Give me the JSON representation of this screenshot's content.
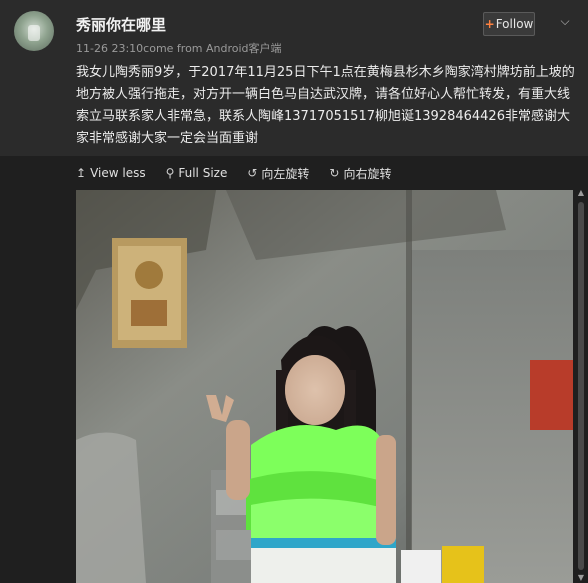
{
  "user": {
    "name": "秀丽你在哪里",
    "meta": "11-26 23:10come from Android客户端"
  },
  "follow": {
    "plus": "+",
    "label": "Follow"
  },
  "post": {
    "text": "我女儿陶秀丽9岁，于2017年11月25日下午1点在黄梅县杉木乡陶家湾村牌坊前上坡的地方被人强行拖走，对方开一辆白色马自达武汉牌，请各位好心人帮忙转发，有重大线索立马联系家人非常急，联系人陶峰13717051517柳旭诞13928464426非常感谢大家非常感谢大家一定会当面重谢"
  },
  "actions": [
    {
      "icon": "arrow-up-icon",
      "label": "View less"
    },
    {
      "icon": "search-icon",
      "label": "Full Size"
    },
    {
      "icon": "rotate-left-icon",
      "label": "向左旋转"
    },
    {
      "icon": "rotate-right-icon",
      "label": "向右旋转"
    }
  ],
  "colors": {
    "background": "#2b2b2b",
    "panel": "#1f1f1f",
    "dress": "#7dff5a",
    "follow_plus": "#ff8140"
  }
}
